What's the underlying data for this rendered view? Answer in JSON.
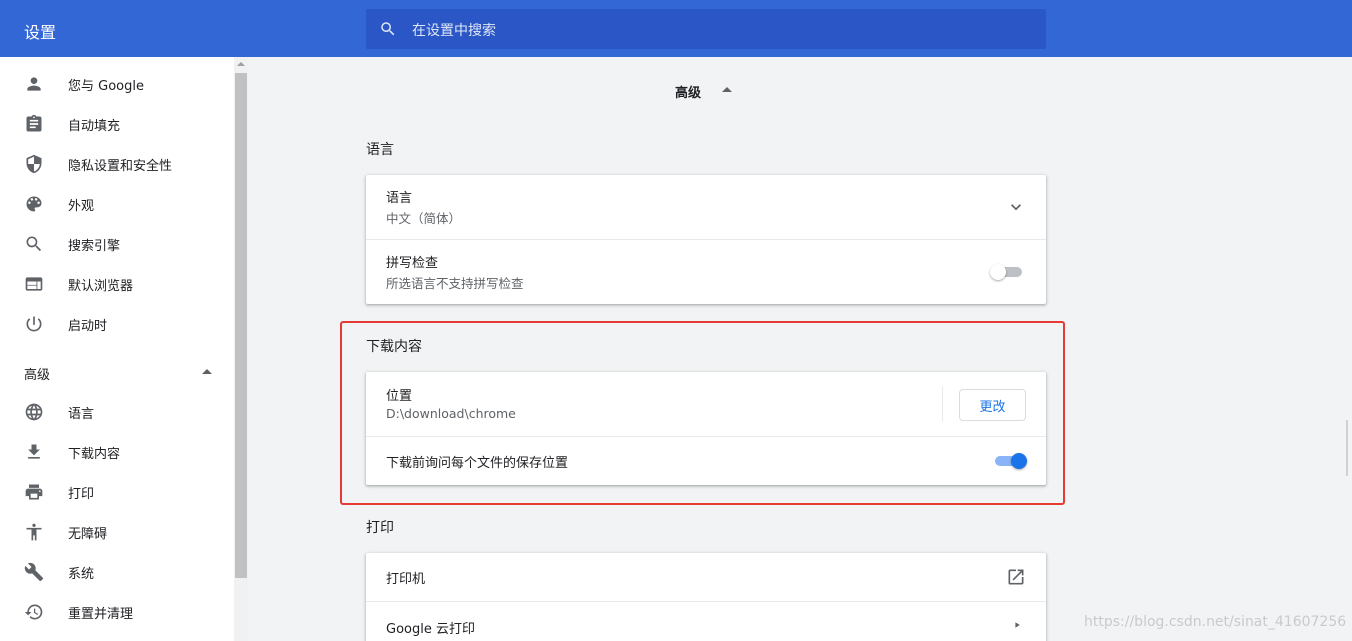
{
  "header": {
    "title": "设置",
    "search_placeholder": "在设置中搜索"
  },
  "sidebar": {
    "items": [
      {
        "label": "您与 Google",
        "icon": "person-icon"
      },
      {
        "label": "自动填充",
        "icon": "clipboard-icon"
      },
      {
        "label": "隐私设置和安全性",
        "icon": "shield-icon"
      },
      {
        "label": "外观",
        "icon": "palette-icon"
      },
      {
        "label": "搜索引擎",
        "icon": "search-icon"
      },
      {
        "label": "默认浏览器",
        "icon": "browser-icon"
      },
      {
        "label": "启动时",
        "icon": "power-icon"
      }
    ],
    "advanced_label": "高级",
    "advanced_items": [
      {
        "label": "语言",
        "icon": "globe-icon"
      },
      {
        "label": "下载内容",
        "icon": "download-icon"
      },
      {
        "label": "打印",
        "icon": "printer-icon"
      },
      {
        "label": "无障碍",
        "icon": "accessibility-icon"
      },
      {
        "label": "系统",
        "icon": "wrench-icon"
      },
      {
        "label": "重置并清理",
        "icon": "restore-icon"
      }
    ]
  },
  "main": {
    "advanced_label": "高级",
    "language_section": {
      "title": "语言",
      "language_row": {
        "title": "语言",
        "value": "中文（简体）"
      },
      "spellcheck_row": {
        "title": "拼写检查",
        "subtitle": "所选语言不支持拼写检查",
        "enabled": false
      }
    },
    "downloads_section": {
      "title": "下载内容",
      "location_row": {
        "title": "位置",
        "value": "D:\\download\\chrome",
        "button": "更改"
      },
      "ask_row": {
        "title": "下载前询问每个文件的保存位置",
        "enabled": true
      }
    },
    "print_section": {
      "title": "打印",
      "printers_row": {
        "title": "打印机"
      },
      "cloud_print_row": {
        "title": "Google 云打印"
      }
    }
  },
  "watermark": "https://blog.csdn.net/sinat_41607256",
  "colors": {
    "header_bg": "#3367d6",
    "search_bg": "#2a56c6",
    "accent": "#1a73e8",
    "highlight_border": "#e53935"
  }
}
